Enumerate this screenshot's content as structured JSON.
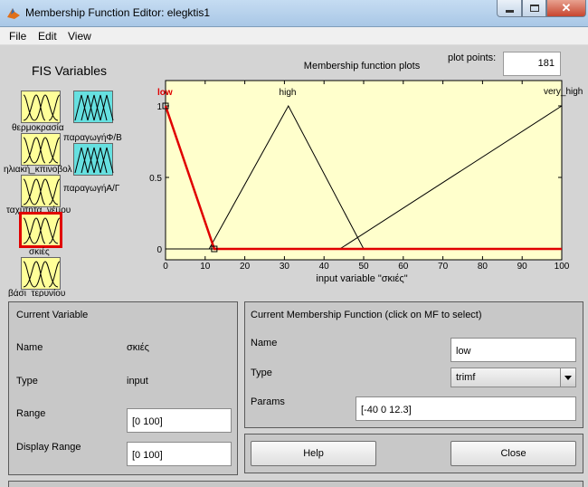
{
  "window": {
    "title": "Membership Function Editor: elegktis1"
  },
  "menu": {
    "file": "File",
    "edit": "Edit",
    "view": "View"
  },
  "fis_variables": {
    "title": "FIS Variables",
    "inputs": [
      {
        "label": "θερμοκρασία"
      },
      {
        "label": "ηλιακή_κπινοβολ"
      },
      {
        "label": "ταχύτητα_νέμου"
      },
      {
        "label": "σκιές",
        "selected": true
      },
      {
        "label": "βάσι_τερυνίου"
      }
    ],
    "outputs": [
      {
        "label": "παραγωγήΦ/Β"
      },
      {
        "label": "παραγωγήΑ/Γ"
      }
    ]
  },
  "plot": {
    "title": "Membership function plots",
    "plot_points_label": "plot points:",
    "plot_points_value": "181",
    "xlabel": "input variable \"σκιές\""
  },
  "chart_data": {
    "type": "line",
    "title": "Membership function plots",
    "xlabel": "input variable \"σκιές\"",
    "ylabel": "",
    "xlim": [
      0,
      100
    ],
    "ylim": [
      0,
      1
    ],
    "x_ticks": [
      "0",
      "10",
      "20",
      "30",
      "40",
      "50",
      "60",
      "70",
      "80",
      "90",
      "100"
    ],
    "y_ticks": [
      "0",
      "0.5",
      "1"
    ],
    "grid": false,
    "series": [
      {
        "name": "low",
        "color": "#e00000",
        "selected": true,
        "x": [
          0,
          12.3,
          100
        ],
        "y": [
          1,
          0,
          0
        ]
      },
      {
        "name": "high",
        "color": "#000000",
        "x": [
          0,
          11,
          31,
          50,
          100
        ],
        "y": [
          0,
          0,
          1,
          0,
          0
        ]
      },
      {
        "name": "very_high",
        "color": "#000000",
        "x": [
          0,
          44,
          100
        ],
        "y": [
          0,
          0,
          1
        ]
      }
    ]
  },
  "current_variable": {
    "title": "Current Variable",
    "name_label": "Name",
    "name_value": "σκιές",
    "type_label": "Type",
    "type_value": "input",
    "range_label": "Range",
    "range_value": "[0 100]",
    "display_range_label": "Display Range",
    "display_range_value": "[0 100]"
  },
  "current_mf": {
    "title": "Current Membership Function (click on MF to select)",
    "name_label": "Name",
    "name_value": "low",
    "type_label": "Type",
    "type_value": "trimf",
    "params_label": "Params",
    "params_value": "[-40 0 12.3]"
  },
  "buttons": {
    "help": "Help",
    "close": "Close"
  },
  "colors": {
    "plot_bg": "#ffffcc",
    "selected": "#e00000",
    "mf_input_bg": "#ffff99",
    "mf_output_bg": "#66e0e0"
  }
}
